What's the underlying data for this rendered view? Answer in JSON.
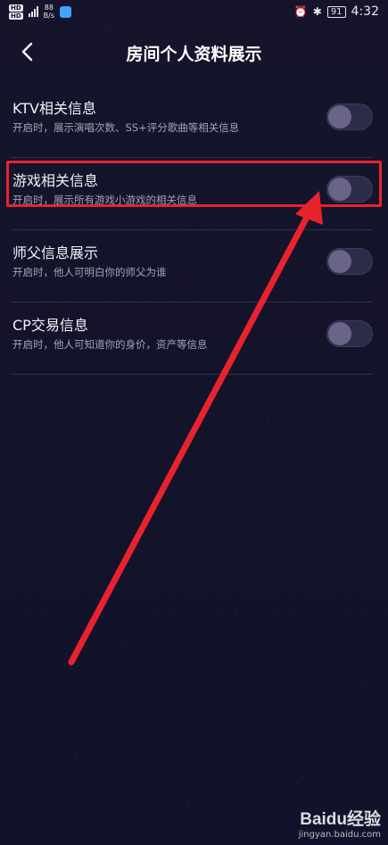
{
  "status_bar": {
    "hd_top": "HD",
    "hd_bottom": "HD",
    "network_top": "4G",
    "network_bottom": "4G",
    "speed_value": "88",
    "speed_unit": "B/s",
    "battery": "91",
    "time": "4:32"
  },
  "header": {
    "title": "房间个人资料展示"
  },
  "settings": [
    {
      "title": "KTV相关信息",
      "desc": "开启时，展示演唱次数、SS+评分歌曲等相关信息",
      "enabled": false
    },
    {
      "title": "游戏相关信息",
      "desc": "开启时，展示所有游戏小游戏的相关信息",
      "enabled": false
    },
    {
      "title": "师父信息展示",
      "desc": "开启时，他人可明白你的师父为谁",
      "enabled": false
    },
    {
      "title": "CP交易信息",
      "desc": "开启时，他人可知道你的身价，资产等信息",
      "enabled": false
    }
  ],
  "annotation": {
    "color": "#e8232e"
  },
  "watermark": {
    "logo": "Baidu经验",
    "url": "jingyan.baidu.com"
  }
}
